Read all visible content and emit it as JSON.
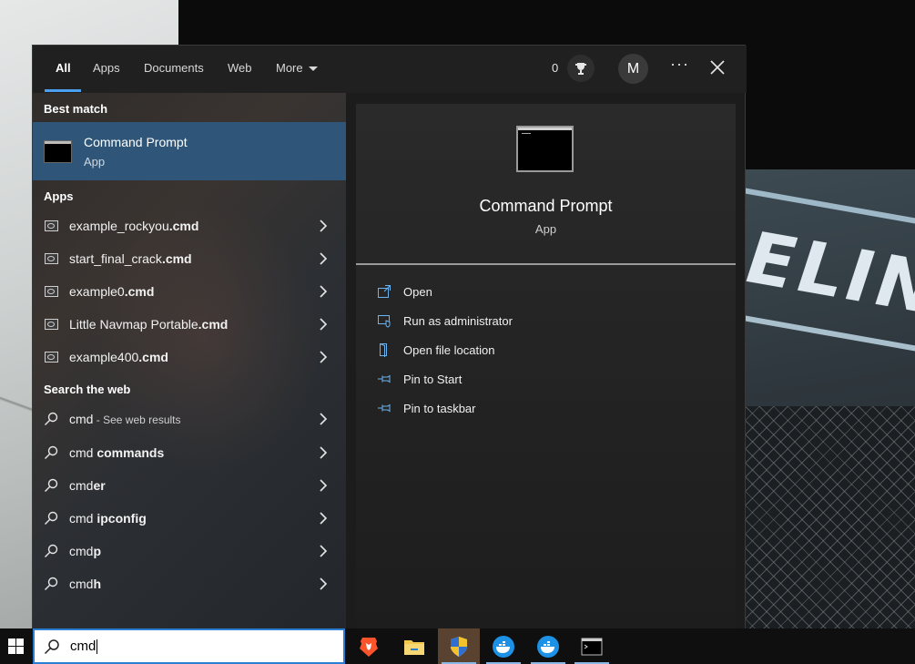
{
  "tabs": [
    {
      "label": "All"
    },
    {
      "label": "Apps"
    },
    {
      "label": "Documents"
    },
    {
      "label": "Web"
    },
    {
      "label": "More"
    }
  ],
  "header": {
    "points": "0",
    "avatar_initial": "M",
    "more_options": "···"
  },
  "best_match": {
    "section_label": "Best match",
    "title": "Command Prompt",
    "subtitle": "App"
  },
  "apps": {
    "section_label": "Apps",
    "items": [
      {
        "name": "example_rockyou",
        "ext": ".cmd"
      },
      {
        "name": "start_final_crack",
        "ext": ".cmd"
      },
      {
        "name": "example0",
        "ext": ".cmd"
      },
      {
        "name": "Little Navmap Portable",
        "ext": ".cmd"
      },
      {
        "name": "example400",
        "ext": ".cmd"
      }
    ]
  },
  "web": {
    "section_label": "Search the web",
    "items": [
      {
        "plain": "cmd",
        "bold": "",
        "suffix": " - See web results"
      },
      {
        "plain": "cmd",
        "bold": " commands",
        "suffix": ""
      },
      {
        "plain": "cmd",
        "bold": "er",
        "suffix": ""
      },
      {
        "plain": "cmd",
        "bold": " ipconfig",
        "suffix": ""
      },
      {
        "plain": "cmd",
        "bold": "p",
        "suffix": ""
      },
      {
        "plain": "cmd",
        "bold": "h",
        "suffix": ""
      }
    ]
  },
  "preview": {
    "title": "Command Prompt",
    "subtitle": "App",
    "actions": [
      {
        "label": "Open",
        "icon": "open-icon"
      },
      {
        "label": "Run as administrator",
        "icon": "shield-icon"
      },
      {
        "label": "Open file location",
        "icon": "folder-location-icon"
      },
      {
        "label": "Pin to Start",
        "icon": "pin-icon"
      },
      {
        "label": "Pin to taskbar",
        "icon": "pin-icon"
      }
    ]
  },
  "search": {
    "value": "cmd"
  },
  "taskbar": {
    "apps": [
      "brave-icon",
      "file-explorer-icon",
      "uac-shield-icon",
      "docker-icon",
      "docker-icon",
      "terminal-icon"
    ]
  },
  "wallpaper": {
    "brand_text": "ELIN"
  },
  "colors": {
    "accent": "#4aa0ef",
    "selection": "#2f5678"
  }
}
